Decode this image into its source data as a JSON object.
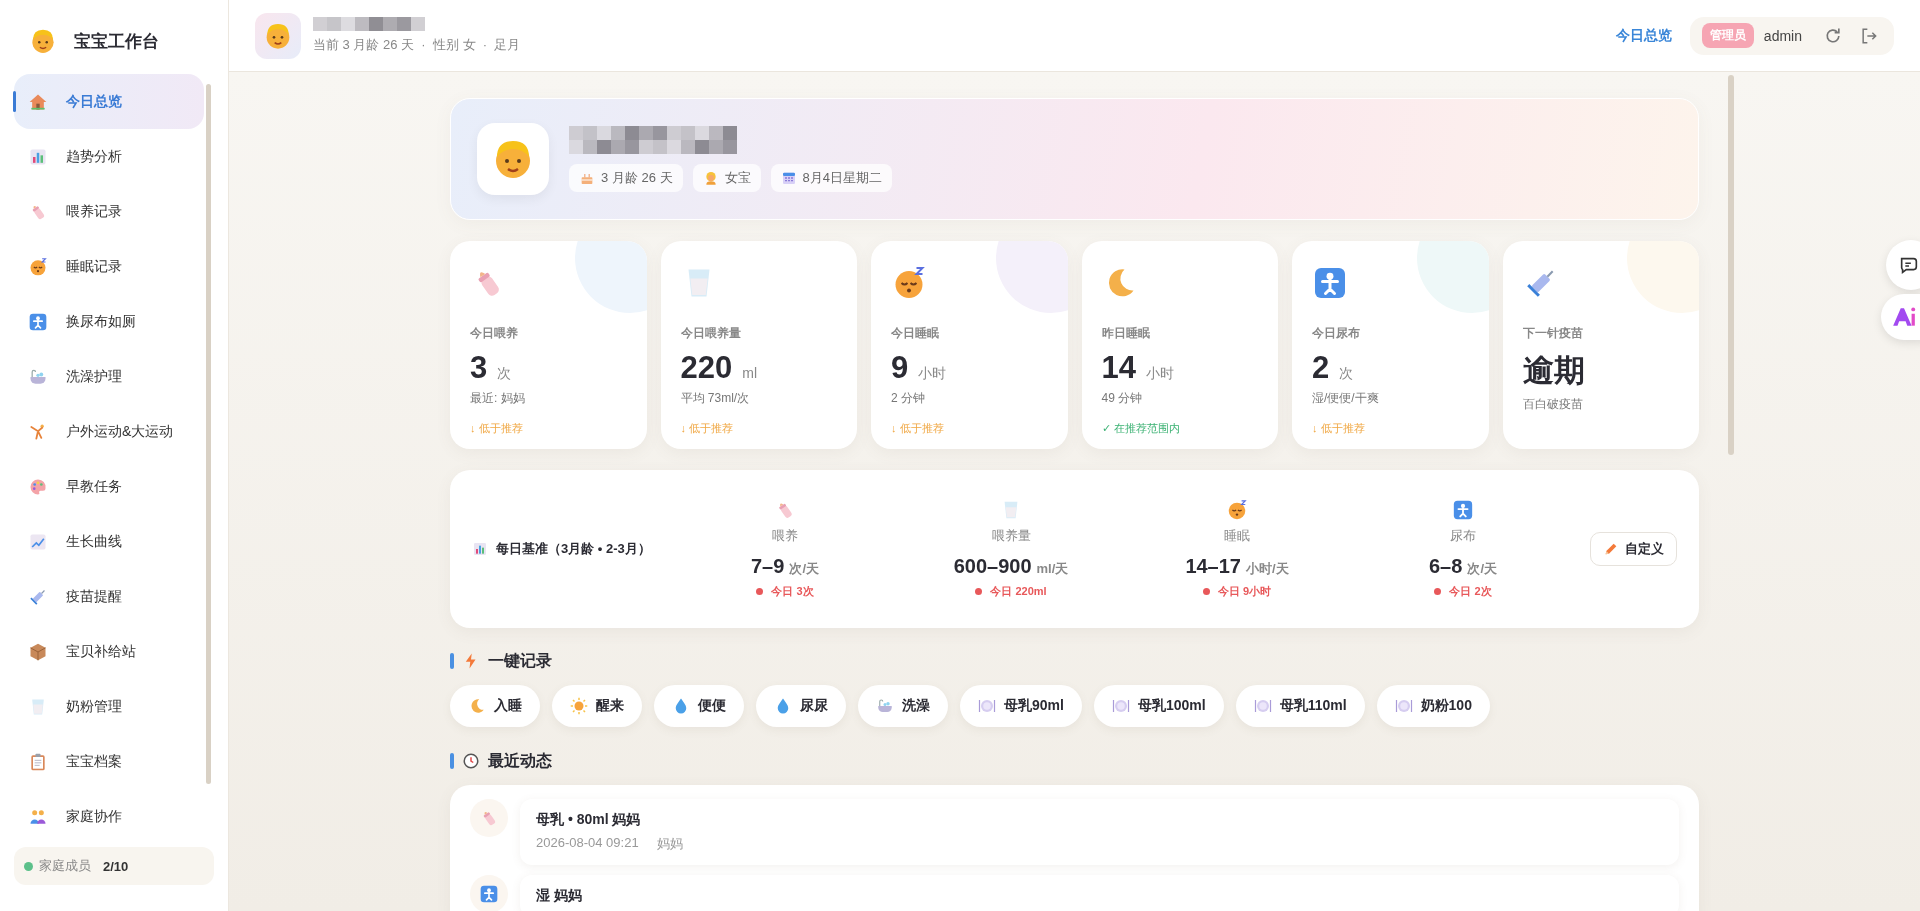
{
  "sidebar": {
    "title": "宝宝工作台",
    "items": [
      {
        "label": "今日总览",
        "selected": true
      },
      {
        "label": "趋势分析",
        "selected": false
      },
      {
        "label": "喂养记录",
        "selected": false
      },
      {
        "label": "睡眠记录",
        "selected": false
      },
      {
        "label": "换尿布如厕",
        "selected": false
      },
      {
        "label": "洗澡护理",
        "selected": false
      },
      {
        "label": "户外运动&大运动",
        "selected": false
      },
      {
        "label": "早教任务",
        "selected": false
      },
      {
        "label": "生长曲线",
        "selected": false
      },
      {
        "label": "疫苗提醒",
        "selected": false
      },
      {
        "label": "宝贝补给站",
        "selected": false
      },
      {
        "label": "奶粉管理",
        "selected": false
      },
      {
        "label": "宝宝档案",
        "selected": false
      },
      {
        "label": "家庭协作",
        "selected": false
      }
    ],
    "footer": {
      "label": "家庭成员",
      "count": "2/10",
      "online": true
    }
  },
  "top_bar": {
    "subtitle": "当前 3 月龄 26 天  ·  性别 女  ·  足月",
    "nav_link": "今日总览",
    "role_badge": "管理员",
    "username": "admin"
  },
  "hero": {
    "chips": [
      "3 月龄 26 天",
      "女宝",
      "8月4日星期二"
    ]
  },
  "stats": [
    {
      "label": "今日喂养",
      "value": "3",
      "unit": "次",
      "detail": "最近: 妈妈",
      "in_range": false,
      "status_text": "↓ 低于推荐"
    },
    {
      "label": "今日喂养量",
      "value": "220",
      "unit": "ml",
      "detail": "平均 73ml/次",
      "in_range": false,
      "status_text": "↓ 低于推荐"
    },
    {
      "label": "今日睡眠",
      "value": "9",
      "unit": "小时",
      "detail": "2 分钟",
      "in_range": false,
      "status_text": "↓ 低于推荐"
    },
    {
      "label": "昨日睡眠",
      "value": "14",
      "unit": "小时",
      "detail": "49 分钟",
      "in_range": true,
      "status_text": "✓ 在推荐范围内"
    },
    {
      "label": "今日尿布",
      "value": "2",
      "unit": "次",
      "detail": "湿/便便/干爽",
      "in_range": false,
      "status_text": "↓ 低于推荐"
    },
    {
      "label": "下一针疫苗",
      "value": "逾期",
      "detail": "百白破疫苗"
    }
  ],
  "baseline": {
    "title": "每日基准（3月龄 • 2-3月）",
    "button": "自定义",
    "items": [
      {
        "label": "喂养",
        "value": "7–9",
        "unit": "次/天",
        "today": "今日 3次",
        "met": false
      },
      {
        "label": "喂养量",
        "value": "600–900",
        "unit": "ml/天",
        "today": "今日 220ml",
        "met": false
      },
      {
        "label": "睡眠",
        "value": "14–17",
        "unit": "小时/天",
        "today": "今日 9小时",
        "met": false
      },
      {
        "label": "尿布",
        "value": "6–8",
        "unit": "次/天",
        "today": "今日 2次",
        "met": false
      }
    ]
  },
  "quick_record": {
    "title": "一键记录",
    "buttons": [
      "入睡",
      "醒来",
      "便便",
      "尿尿",
      "洗澡",
      "母乳90ml",
      "母乳100ml",
      "母乳110ml",
      "奶粉100"
    ]
  },
  "recent": {
    "title": "最近动态",
    "items": [
      {
        "title": "母乳 • 80ml 妈妈",
        "time": "2026-08-04 09:21",
        "by": "妈妈"
      },
      {
        "title": "湿 妈妈"
      }
    ]
  }
}
